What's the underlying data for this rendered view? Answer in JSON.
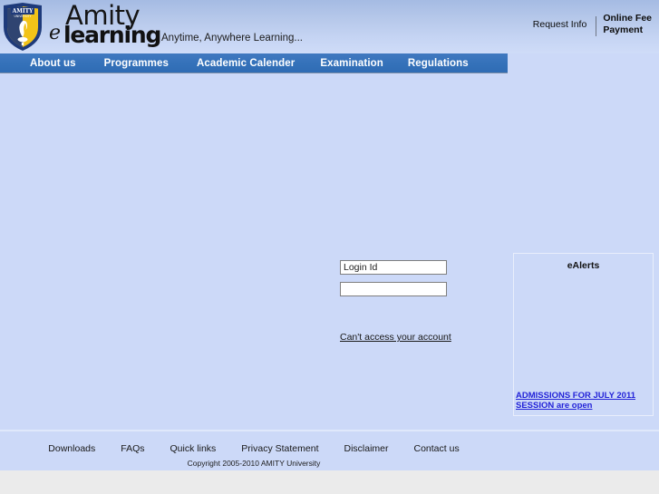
{
  "header": {
    "logo_alt": "Amity University shield",
    "wordmark_top": "Amity",
    "wordmark_e": "e",
    "wordmark_bottom": "learning",
    "tagline": "Anytime, Anywhere Learning...",
    "request_info": "Request Info",
    "online_fee_line1": "Online Fee",
    "online_fee_line2": "Payment"
  },
  "nav": {
    "items": [
      {
        "label": "About us"
      },
      {
        "label": "Programmes"
      },
      {
        "label": "Academic Calender"
      },
      {
        "label": "Examination"
      },
      {
        "label": "Regulations"
      }
    ]
  },
  "login": {
    "login_id_value": "Login Id",
    "login_id_placeholder": "Login Id",
    "password_value": "",
    "password_placeholder": "",
    "forgot_link": "Can't access your account"
  },
  "ealerts": {
    "title": "eAlerts",
    "items": [
      {
        "text": "ADMISSIONS FOR JULY 2011 SESSION are open"
      }
    ]
  },
  "footer": {
    "links": [
      {
        "label": "Downloads"
      },
      {
        "label": "FAQs"
      },
      {
        "label": "Quick links"
      },
      {
        "label": "Privacy Statement"
      },
      {
        "label": "Disclaimer"
      },
      {
        "label": "Contact us"
      }
    ],
    "copyright": "Copyright 2005-2010 AMITY University"
  },
  "colors": {
    "page_background": "#ccd9f8",
    "nav_blue": "#3572ba",
    "header_gradient_top": "#a5bbe3",
    "header_gradient_bottom": "#cfdcf8",
    "shield_blue": "#1e3a7a",
    "shield_gold": "#f2c318",
    "link_blue": "#2323d8",
    "outer_background": "#ebebeb"
  }
}
